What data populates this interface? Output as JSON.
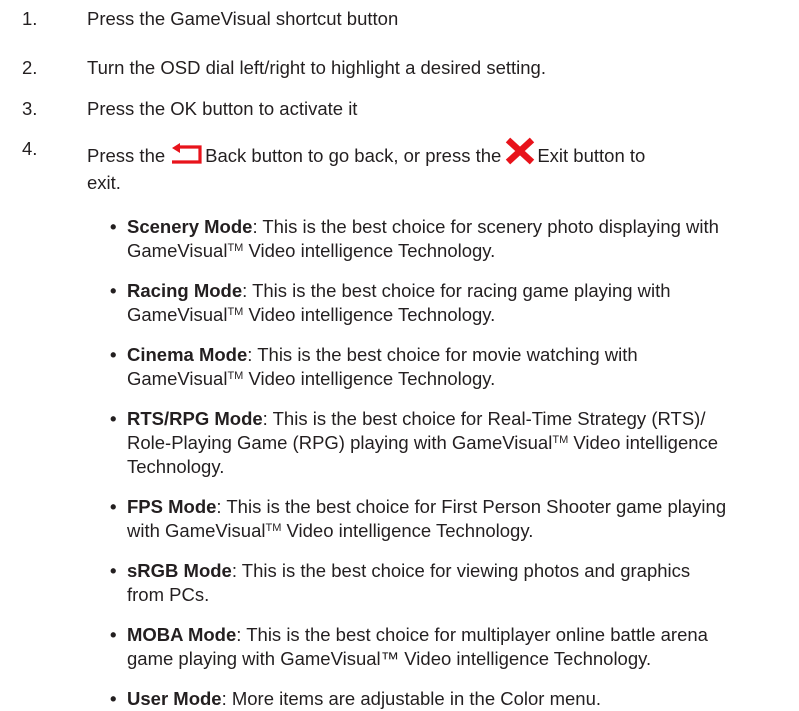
{
  "steps": [
    {
      "number": "1.",
      "text": "Press the GameVisual shortcut button"
    },
    {
      "number": "2.",
      "text": "Turn the OSD dial left/right to highlight a desired setting."
    },
    {
      "number": "3.",
      "text": "Press the OK button to activate it"
    },
    {
      "number": "4.",
      "text_before_back": "Press the",
      "text_back": "Back button to go back, or press the",
      "text_exit": "Exit button to",
      "text_wrap": "exit."
    }
  ],
  "icons": {
    "back_icon": "return-arrow",
    "back_color": "#e8131b",
    "exit_icon": "x-mark",
    "exit_color": "#e8131b"
  },
  "modes": [
    {
      "name": "Scenery Mode",
      "line1": ": This is the best choice for scenery photo displaying with",
      "line2_pre": "GameVisual",
      "tm": "TM",
      "line2_post": " Video intelligence Technology."
    },
    {
      "name": "Racing Mode",
      "line1": ": This is the best choice for racing game playing with",
      "line2_pre": "GameVisual",
      "tm": "TM",
      "line2_post": " Video intelligence Technology."
    },
    {
      "name": "Cinema Mode",
      "line1": ": This is the best choice for movie watching with",
      "line2_pre": "GameVisual",
      "tm": "TM",
      "line2_post": " Video intelligence Technology."
    },
    {
      "name": "RTS/RPG Mode",
      "line1": ": This is the best choice for Real-Time Strategy (RTS)/",
      "line2_pre": "Role-Playing Game (RPG) playing with GameVisual",
      "tm": "TM",
      "line2_post": " Video intelligence",
      "line3": "Technology."
    },
    {
      "name": "FPS Mode",
      "line1": ": This is the best choice for First Person Shooter game playing",
      "line2_pre": "with GameVisual",
      "tm": "TM",
      "line2_post": " Video intelligence Technology."
    },
    {
      "name": "sRGB Mode",
      "line1": ": This is the best choice for viewing photos and graphics",
      "line2_pre": "from PCs.",
      "tm": "",
      "line2_post": ""
    },
    {
      "name": "MOBA Mode",
      "line1": ": This is the best choice for multiplayer online battle arena",
      "line2_pre": "game playing with GameVisual™ Video intelligence Technology.",
      "tm": "",
      "line2_post": ""
    },
    {
      "name": "User Mode",
      "line1": ": More items are adjustable in the Color menu."
    }
  ],
  "bullet_char": "•"
}
